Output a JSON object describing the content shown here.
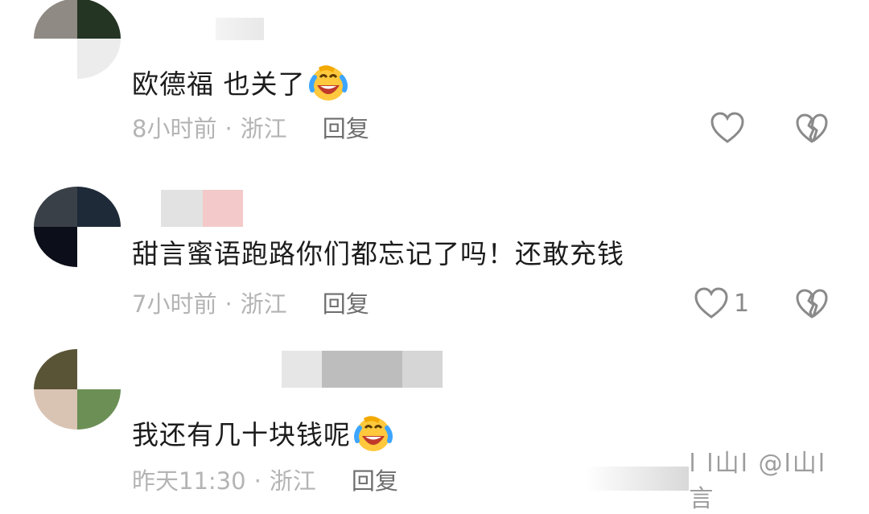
{
  "comments": [
    {
      "text": "欧德福  也关了",
      "time": "8小时前",
      "location": "浙江",
      "reply_label": "回复",
      "like_count": "",
      "emoji": "laughing-crying-emoji"
    },
    {
      "text": "甜言蜜语跑路你们都忘记了吗！还敢充钱",
      "time": "7小时前",
      "location": "浙江",
      "reply_label": "回复",
      "like_count": "1"
    },
    {
      "text": "我还有几十块钱呢",
      "time": "昨天11:30",
      "location": "浙江",
      "reply_label": "回复",
      "like_count": "",
      "emoji": "laughing-crying-emoji"
    }
  ],
  "separator": "·",
  "icons": {
    "like": "heart-outline-icon",
    "dislike": "broken-heart-icon"
  },
  "colors": {
    "text": "#1c1c1c",
    "meta": "#b4b4b4",
    "reply": "#6e6e6e",
    "icon": "#8a8a8a"
  },
  "watermark": "l l山l @l山l 言"
}
